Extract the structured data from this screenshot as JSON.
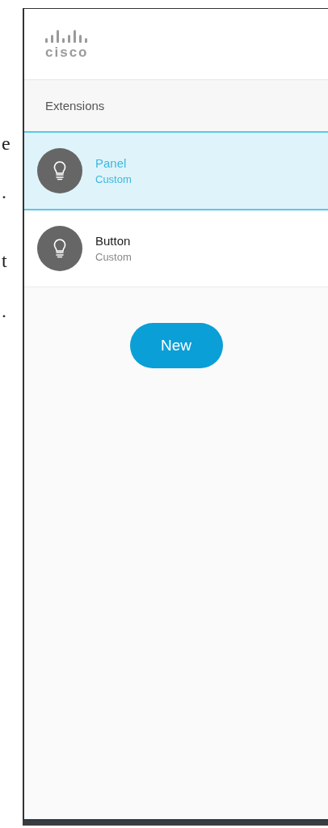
{
  "background_fragments": [
    "e",
    ".",
    "t",
    "."
  ],
  "header": {
    "logo_text": "cisco"
  },
  "section": {
    "title": "Extensions"
  },
  "items": [
    {
      "name": "Panel",
      "type": "Custom",
      "selected": true
    },
    {
      "name": "Button",
      "type": "Custom",
      "selected": false
    }
  ],
  "new_button": {
    "label": "New"
  }
}
